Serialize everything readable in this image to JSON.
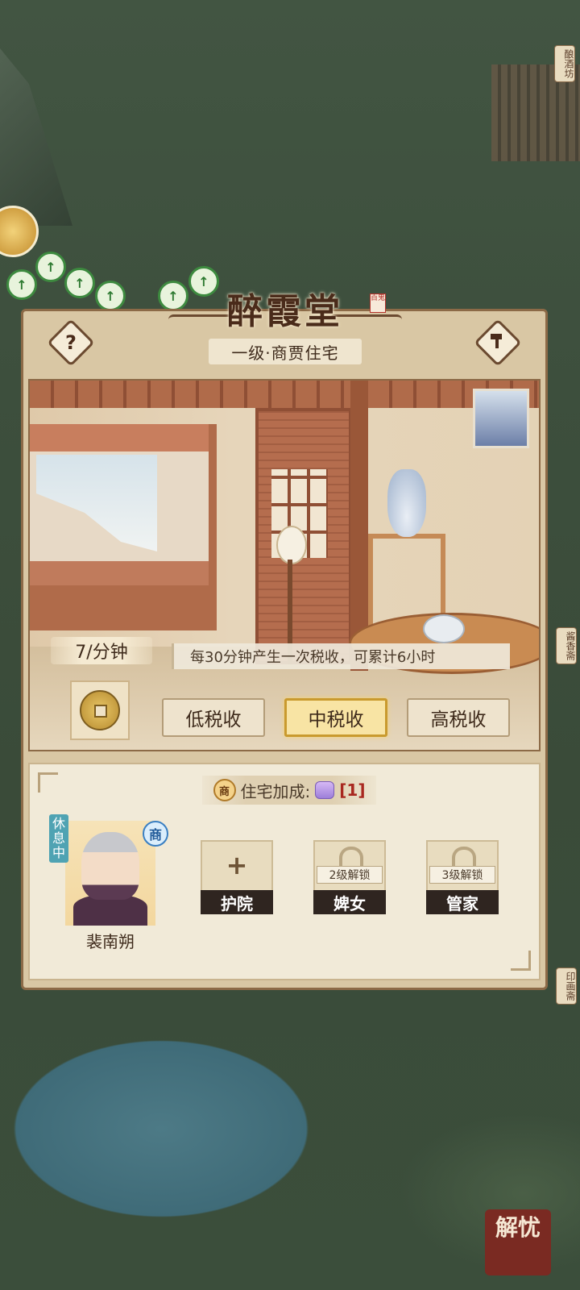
{
  "building": {
    "name": "醉霞堂",
    "seal": "百鬼",
    "level_type": "一级·商贾住宅"
  },
  "buttons": {
    "help": "?",
    "build": "hammer-icon"
  },
  "income": {
    "rate": "7/分钟",
    "info": "每30分钟产生一次税收，可累计6小时"
  },
  "tax_options": [
    {
      "label": "低税收",
      "selected": false
    },
    {
      "label": "中税收",
      "selected": true
    },
    {
      "label": "高税收",
      "selected": false
    }
  ],
  "bonus": {
    "badge": "商",
    "label": "住宅加成:",
    "count": "[1]"
  },
  "resident": {
    "name": "裴南朔",
    "status": "休息中",
    "class_badge": "商"
  },
  "slots": [
    {
      "label": "护院",
      "locked": false,
      "action": "+"
    },
    {
      "label": "婢女",
      "locked": true,
      "unlock_text": "2级解锁"
    },
    {
      "label": "管家",
      "locked": true,
      "unlock_text": "3级解锁"
    }
  ],
  "side_signs": {
    "top_right": "酿酒坊",
    "right_mid": "酱香斋",
    "right_low": "印画斋"
  },
  "corner_button": "解忧",
  "colors": {
    "panel": "#d9c7a4",
    "active_tax": "#f8e4a4",
    "rest_tag": "#4fa3b3",
    "bonus_count": "#a8271f"
  }
}
